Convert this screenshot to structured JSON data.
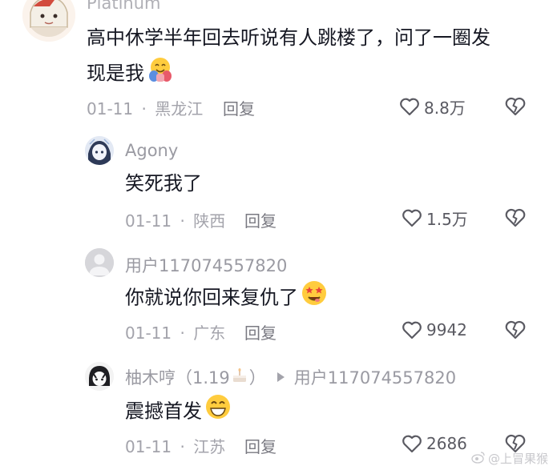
{
  "comments": [
    {
      "username": "Platinum",
      "text_line1": "高中休学半年回去听说有人跳楼了，问了一圈发",
      "text_line2": "现是我",
      "emoji": "hugging-face-emoji",
      "date": "01-11",
      "location": "黑龙江",
      "reply": "回复",
      "likes": "8.8万"
    },
    {
      "username": "Agony",
      "text": "笑死我了",
      "date": "01-11",
      "location": "陕西",
      "reply": "回复",
      "likes": "1.5万"
    },
    {
      "username": "用户117074557820",
      "text": "你就说你回来复仇了",
      "emoji": "star-eyes-face-emoji",
      "date": "01-11",
      "location": "广东",
      "reply": "回复",
      "likes": "9942"
    },
    {
      "username": "柚木哼（1.19",
      "username_suffix": "）",
      "reply_to": "用户117074557820",
      "text": "震撼首发",
      "emoji": "grinning-face-emoji",
      "date": "01-11",
      "location": "江苏",
      "reply": "回复",
      "likes": "2686"
    }
  ],
  "separator": "·",
  "watermark": "@上冒果猴",
  "colors": {
    "text": "#161823",
    "meta": "#a3a3ab",
    "icon": "#5a5a62"
  }
}
